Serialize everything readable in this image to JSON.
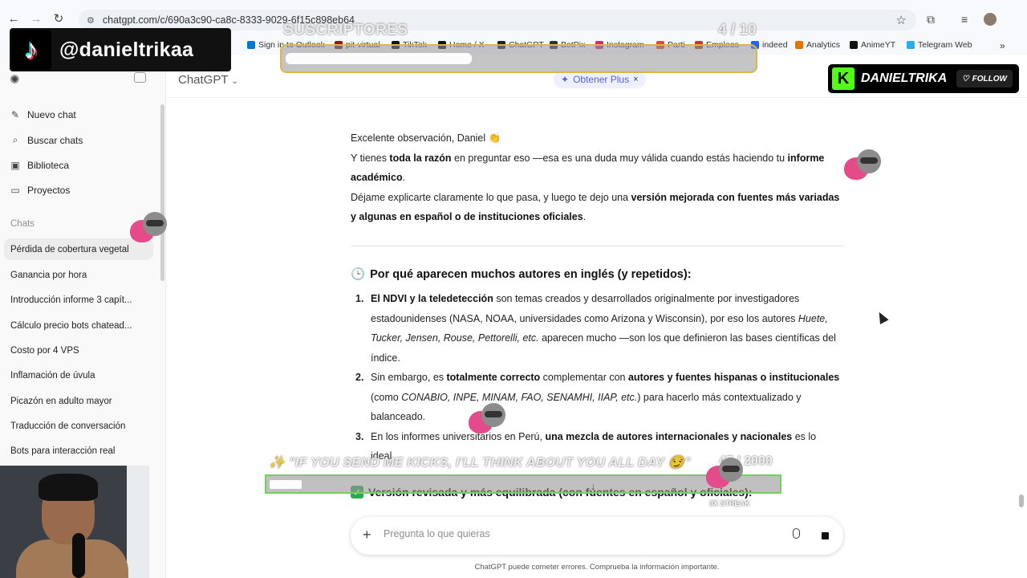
{
  "browser": {
    "url": "chatgpt.com/c/690a3c90-ca8c-8333-9029-6f15c898eb64",
    "bookmarks": [
      {
        "label": "Sign in to Outlook",
        "color": "#0078d4"
      },
      {
        "label": "pit-virtual",
        "color": "#8b1a1a"
      },
      {
        "label": "TikTok",
        "color": "#111111"
      },
      {
        "label": "Home / X",
        "color": "#111111"
      },
      {
        "label": "ChatGPT",
        "color": "#222222"
      },
      {
        "label": "BotPix",
        "color": "#333333"
      },
      {
        "label": "Instagram",
        "color": "#d62976"
      },
      {
        "label": "Parti",
        "color": "#e04a2f"
      },
      {
        "label": "Empleos",
        "color": "#c0392b"
      },
      {
        "label": "indeed",
        "color": "#2164f3"
      },
      {
        "label": "Analytics",
        "color": "#e37400"
      },
      {
        "label": "AnimeYT",
        "color": "#111111"
      },
      {
        "label": "Telegram Web",
        "color": "#2aabee"
      }
    ]
  },
  "sidebar": {
    "nav": [
      {
        "label": "Nuevo chat",
        "icon": "pencil-icon"
      },
      {
        "label": "Buscar chats",
        "icon": "search-icon"
      },
      {
        "label": "Biblioteca",
        "icon": "library-icon"
      },
      {
        "label": "Proyectos",
        "icon": "folder-icon"
      }
    ],
    "section_label": "Chats",
    "chats": [
      "Pérdida de cobertura vegetal",
      "Ganancia por hora",
      "Introducción informe 3 capít...",
      "Cálculo precio bots chatead...",
      "Costo por 4 VPS",
      "Inflamación de úvula",
      "Picazón en adulto mayor",
      "Traducción de conversación",
      "Bots para interacción real"
    ]
  },
  "header": {
    "model": "ChatGPT",
    "plus_label": "Obtener Plus"
  },
  "message": {
    "greeting": "Excelente observación, Daniel",
    "p1_a": "Y tienes ",
    "p1_b": "toda la razón",
    "p1_c": " en preguntar eso —esa es una duda muy válida cuando estás haciendo tu ",
    "p1_d": "informe académico",
    "p1_e": ".",
    "p2_a": "Déjame explicarte claramente lo que pasa, y luego te dejo una ",
    "p2_b": "versión mejorada con fuentes más variadas y algunas en español o de instituciones oficiales",
    "p2_c": ".",
    "heading": "Por qué aparecen muchos autores en inglés (y repetidos):",
    "item1_a": "El NDVI y la teledetección",
    "item1_b": " son temas creados y desarrollados originalmente por investigadores estadounidenses (NASA, NOAA, universidades como Arizona y Wisconsin), por eso los autores ",
    "item1_c": "Huete, Tucker, Jensen, Rouse, Pettorelli, etc.",
    "item1_d": " aparecen mucho —son los que definieron las bases científicas del índice.",
    "item2_a": "Sin embargo, es ",
    "item2_b": "totalmente correcto",
    "item2_c": " complementar con ",
    "item2_d": "autores y fuentes hispanas o institucionales",
    "item2_e": " (como ",
    "item2_f": "CONABIO, INPE, MINAM, FAO, SENAMHI, IIAP, etc.",
    "item2_g": ") para hacerlo más contextualizado y balanceado.",
    "item3_a": "En los informes universitarios en Perú, ",
    "item3_b": "una mezcla de autores internacionales y nacionales",
    "item3_c": " es lo ideal.",
    "heading2": "Versión revisada y más equilibrada (con fuentes en español y oficiales):"
  },
  "composer": {
    "placeholder": "Pregunta lo que quieras",
    "disclaimer": "ChatGPT puede cometer errores. Comprueba la información importante."
  },
  "overlay": {
    "tiktok_handle": "@danieltrikaa",
    "subs_title": "SUSCRIPTORES",
    "subs_count": "4 / 10",
    "subs_progress": 0.4,
    "kick_name": "DANIELTRIKA",
    "kick_follow": "FOLLOW",
    "kicks_message": "\"IF YOU SEND ME KICKS, I'LL THINK ABOUT YOU ALL DAY 😏\"",
    "kicks_count": "47 / 2000",
    "kicks_progress": 0.0235,
    "streak": "3X STREAK",
    "kick_brand_color": "#53fc18"
  }
}
